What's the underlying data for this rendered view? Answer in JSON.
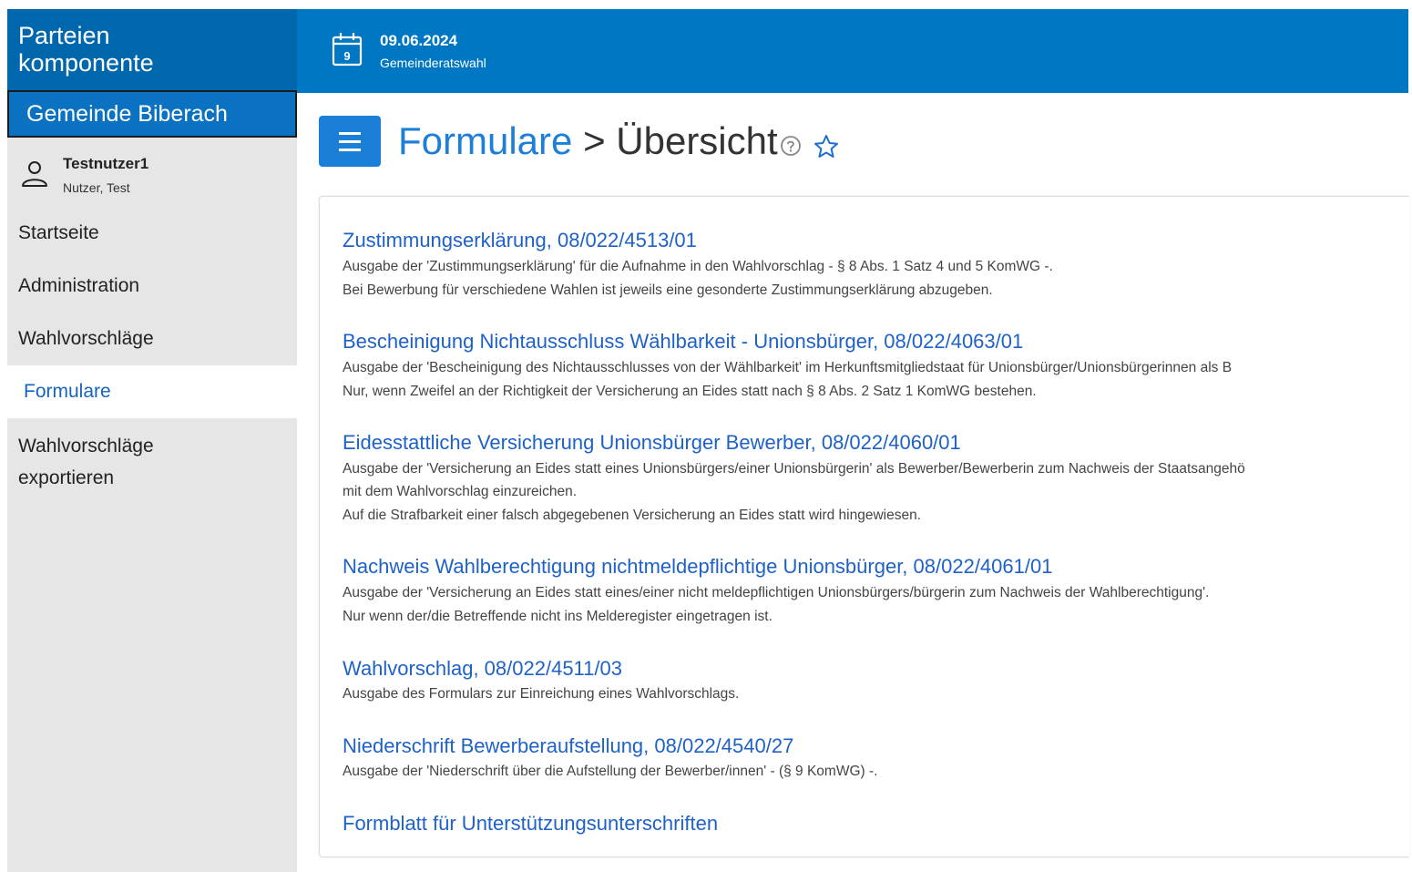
{
  "app": {
    "brand_line1": "Parteien",
    "brand_line2": "komponente",
    "municipality": "Gemeinde Biberach"
  },
  "user": {
    "username": "Testnutzer1",
    "display_name": "Nutzer, Test",
    "icon": "user-icon"
  },
  "nav": {
    "items": [
      {
        "label": "Startseite",
        "active": false
      },
      {
        "label": "Administration",
        "active": false
      },
      {
        "label": "Wahlvorschläge",
        "active": false
      },
      {
        "label": "Formulare",
        "active": true
      },
      {
        "label": "Wahlvorschläge",
        "label_line2": "exportieren",
        "active": false
      }
    ]
  },
  "header": {
    "election_date": "09.06.2024",
    "election_type": "Gemeinderatswahl",
    "calendar_day": "9"
  },
  "page": {
    "breadcrumb_link": "Formulare",
    "breadcrumb_sep": ">",
    "breadcrumb_current": "Übersicht",
    "help_icon": "help-circle-icon",
    "favorite_icon": "star-outline-icon"
  },
  "forms": [
    {
      "title": "Zustimmungserklärung, 08/022/4513/01",
      "desc": [
        "Ausgabe der 'Zustimmungserklärung' für die Aufnahme in den Wahlvorschlag - § 8 Abs. 1 Satz 4 und 5 KomWG -.",
        "Bei Bewerbung für verschiedene Wahlen ist jeweils eine gesonderte Zustimmungserklärung abzugeben."
      ]
    },
    {
      "title": "Bescheinigung Nichtausschluss Wählbarkeit - Unionsbürger, 08/022/4063/01",
      "desc": [
        "Ausgabe der 'Bescheinigung des Nichtausschlusses von der Wählbarkeit' im Herkunftsmitgliedstaat für Unionsbürger/Unionsbürgerinnen als B",
        "Nur, wenn Zweifel an der Richtigkeit der Versicherung an Eides statt nach § 8 Abs. 2 Satz 1 KomWG bestehen."
      ]
    },
    {
      "title": "Eidesstattliche Versicherung Unionsbürger Bewerber, 08/022/4060/01",
      "desc": [
        "Ausgabe der 'Versicherung an Eides statt eines Unionsbürgers/einer Unionsbürgerin' als Bewerber/Bewerberin zum Nachweis der Staatsangehö",
        "mit dem Wahlvorschlag einzureichen.",
        "Auf die Strafbarkeit einer falsch abgegebenen Versicherung an Eides statt wird hingewiesen."
      ]
    },
    {
      "title": "Nachweis Wahlberechtigung nichtmeldepflichtige Unionsbürger, 08/022/4061/01",
      "desc": [
        "Ausgabe der 'Versicherung an Eides statt eines/einer nicht meldepflichtigen Unionsbürgers/bürgerin zum Nachweis der Wahlberechtigung'.",
        "Nur wenn der/die Betreffende nicht ins Melderegister eingetragen ist."
      ]
    },
    {
      "title": "Wahlvorschlag, 08/022/4511/03",
      "desc": [
        "Ausgabe des Formulars zur Einreichung eines Wahlvorschlags."
      ]
    },
    {
      "title": "Niederschrift Bewerberaufstellung, 08/022/4540/27",
      "desc": [
        "Ausgabe der 'Niederschrift über die Aufstellung der Bewerber/innen' - (§ 9 KomWG) -."
      ]
    },
    {
      "title": "Formblatt für Unterstützungsunterschriften",
      "desc": []
    }
  ]
}
